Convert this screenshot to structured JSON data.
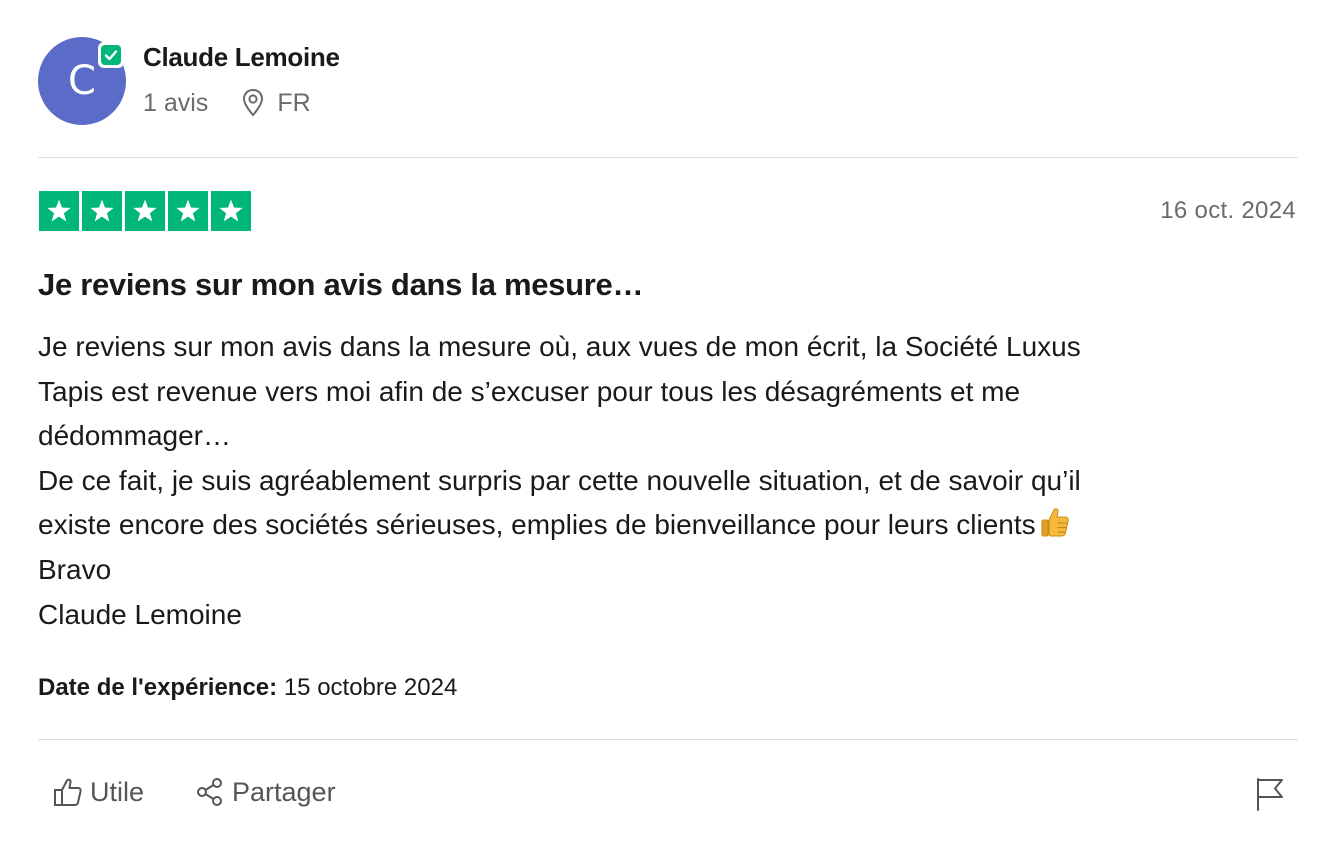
{
  "reviewer": {
    "initial": "C",
    "name": "Claude Lemoine",
    "reviews_count": "1 avis",
    "country": "FR",
    "avatar_color": "#5a6bc8",
    "verified_color": "#00b67a"
  },
  "review": {
    "rating": 5,
    "max_rating": 5,
    "star_color": "#00b67a",
    "date": "16 oct. 2024",
    "title": "Je reviens sur mon avis dans la mesure…",
    "body_lines": [
      "Je reviens sur mon avis dans la mesure où, aux vues de mon écrit, la Société Luxus",
      "Tapis est revenue vers moi afin de s’excuser pour tous les désagréments et me",
      "dédommager…",
      "De ce fait, je suis agréablement surpris par cette nouvelle situation, et de savoir qu’il",
      "existe encore des sociétés sérieuses, emplies de bienveillance pour leurs clients",
      "Bravo",
      "Claude Lemoine"
    ],
    "body_emoji": "thumbs-up-emoji",
    "experience_label": "Date de l'expérience:",
    "experience_date": "15 octobre 2024"
  },
  "actions": {
    "useful_label": "Utile",
    "share_label": "Partager",
    "useful_icon": "thumbs-up-icon",
    "share_icon": "share-icon",
    "report_icon": "flag-icon"
  }
}
